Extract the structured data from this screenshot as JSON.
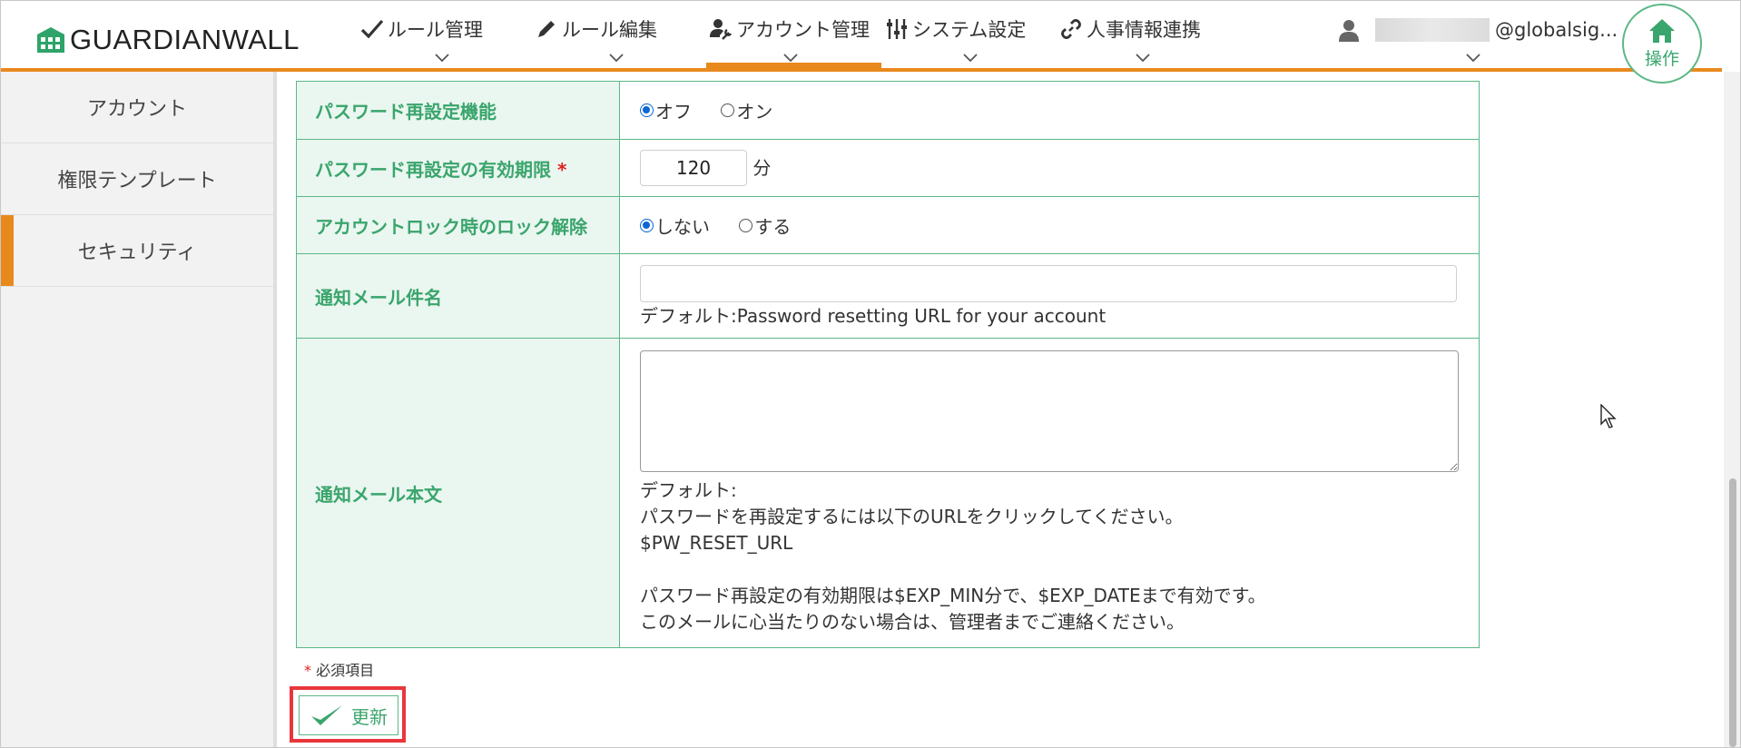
{
  "header": {
    "logo_text": "GUARDIANWALL",
    "nav": [
      {
        "label": "ルール管理",
        "icon": "check-icon"
      },
      {
        "label": "ルール編集",
        "icon": "pencil-icon"
      },
      {
        "label": "アカウント管理",
        "icon": "user-wrench-icon",
        "active": true
      },
      {
        "label": "システム設定",
        "icon": "sliders-icon"
      },
      {
        "label": "人事情報連携",
        "icon": "link-icon"
      }
    ],
    "user_text": "@globalsig...",
    "operation_label": "操作"
  },
  "sidebar": {
    "items": [
      {
        "label": "アカウント"
      },
      {
        "label": "権限テンプレート"
      },
      {
        "label": "セキュリティ",
        "active": true
      }
    ]
  },
  "form": {
    "password_reset": {
      "label": "パスワード再設定機能",
      "options": [
        "オフ",
        "オン"
      ],
      "selected": "オフ"
    },
    "reset_expiry": {
      "label": "パスワード再設定の有効期限",
      "required_mark": "*",
      "value": "120",
      "unit": "分"
    },
    "unlock": {
      "label": "アカウントロック時のロック解除",
      "options": [
        "しない",
        "する"
      ],
      "selected": "しない"
    },
    "mail_subject": {
      "label": "通知メール件名",
      "value": "",
      "default_text": "デフォルト:Password resetting URL for your account"
    },
    "mail_body": {
      "label": "通知メール本文",
      "value": "",
      "default_lines": [
        "デフォルト:",
        "パスワードを再設定するには以下のURLをクリックしてください。",
        "$PW_RESET_URL",
        "",
        "パスワード再設定の有効期限は$EXP_MIN分で、$EXP_DATEまで有効です。",
        "このメールに心当たりのない場合は、管理者までご連絡ください。"
      ]
    }
  },
  "footer": {
    "required_mark": "*",
    "required_note": "必須項目",
    "update_label": "更新"
  },
  "colors": {
    "accent": "#e8891d",
    "green": "#3aa56c",
    "label_bg": "#eaf6f0",
    "highlight": "#e8363c"
  }
}
